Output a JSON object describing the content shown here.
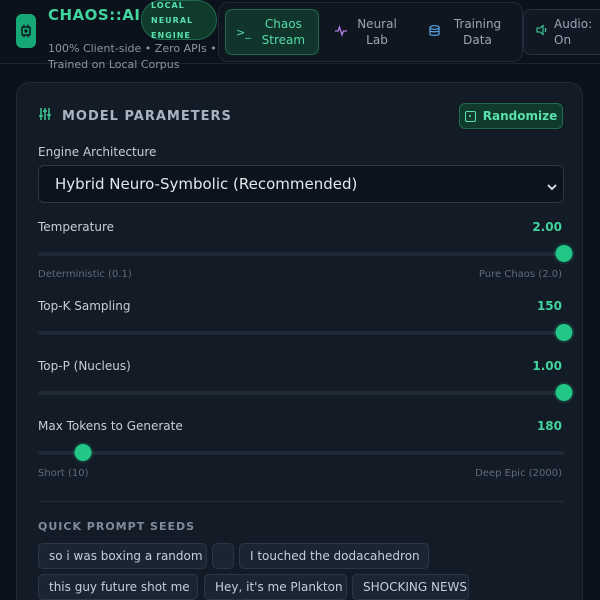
{
  "app": {
    "brand": "CHAOS::AI",
    "badge": "LOCAL NEURAL ENGINE",
    "subtitle": "100% Client-side • Zero APIs • Trained on Local Corpus"
  },
  "tabs": [
    {
      "label": "Chaos Stream",
      "icon": "terminal-icon",
      "active": true
    },
    {
      "label": "Neural Lab",
      "icon": "activity-icon",
      "active": false
    },
    {
      "label": "Training Data",
      "icon": "database-icon",
      "active": false
    }
  ],
  "audio": {
    "label": "Audio: On",
    "icon": "speaker-icon"
  },
  "panel": {
    "title": "MODEL PARAMETERS",
    "randomize_label": "Randomize",
    "engine_label": "Engine Architecture",
    "engine_value": "Hybrid Neuro-Symbolic (Recommended)",
    "params": {
      "temperature": {
        "label": "Temperature",
        "value": "2.00",
        "fraction": 1.0,
        "min_hint": "Deterministic (0.1)",
        "max_hint": "Pure Chaos (2.0)"
      },
      "topk": {
        "label": "Top-K Sampling",
        "value": "150",
        "fraction": 1.0
      },
      "topp": {
        "label": "Top-P (Nucleus)",
        "value": "1.00",
        "fraction": 1.0
      },
      "maxtokens": {
        "label": "Max Tokens to Generate",
        "value": "180",
        "fraction": 0.085,
        "min_hint": "Short (10)",
        "max_hint": "Deep Epic (2000)"
      }
    },
    "seeds_title": "QUICK PROMPT SEEDS",
    "seeds": [
      "so i was boxing a random",
      "",
      "I touched the dodacahedron",
      "this guy future shot me",
      "Hey, it's me Plankton",
      "SHOCKING NEWS:"
    ]
  },
  "colors": {
    "accent": "#22c687",
    "background": "#0c121b",
    "panel": "#131b27"
  }
}
